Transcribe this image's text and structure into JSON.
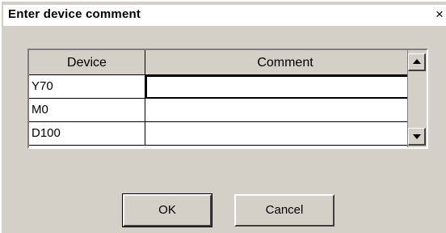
{
  "dialog": {
    "title": "Enter device comment",
    "close_label": "×"
  },
  "grid": {
    "columns": [
      "Device",
      "Comment"
    ],
    "rows": [
      {
        "device": "Y70",
        "comment": ""
      },
      {
        "device": "M0",
        "comment": ""
      },
      {
        "device": "D100",
        "comment": ""
      }
    ]
  },
  "buttons": {
    "ok_label": "OK",
    "cancel_label": "Cancel"
  }
}
